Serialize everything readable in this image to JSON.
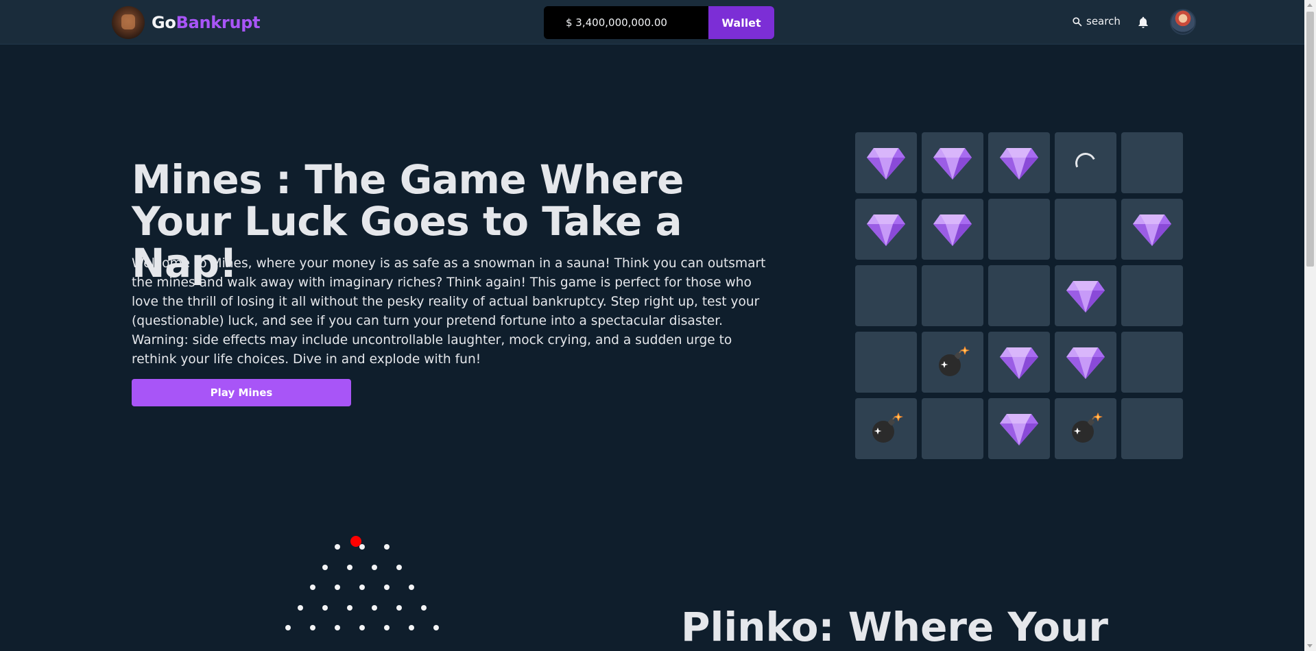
{
  "header": {
    "logo_go": "Go",
    "logo_bankrupt": "Bankrupt",
    "balance": "$ 3,400,000,000.00",
    "wallet_label": "Wallet",
    "search_label": "search"
  },
  "hero": {
    "title": "Mines : The Game Where Your Luck Goes to Take a Nap!",
    "description": "Welcome to Mines, where your money is as safe as a snowman in a sauna! Think you can outsmart the mines and walk away with imaginary riches? Think again! This game is perfect for those who love the thrill of losing it all without the pesky reality of actual bankruptcy. Step right up, test your (questionable) luck, and see if you can turn your pretend fortune into a spectacular disaster. Warning: side effects may include uncontrollable laughter, mock crying, and a sudden urge to rethink your life choices. Dive in and explode with fun!",
    "play_label": "Play Mines"
  },
  "mines_grid": [
    [
      "gem",
      "gem",
      "gem",
      "loading",
      "empty"
    ],
    [
      "gem",
      "gem",
      "empty",
      "empty",
      "gem"
    ],
    [
      "empty",
      "empty",
      "empty",
      "gem",
      "empty"
    ],
    [
      "empty",
      "bomb",
      "gem",
      "gem",
      "empty"
    ],
    [
      "bomb",
      "empty",
      "gem",
      "bomb",
      "empty"
    ]
  ],
  "plinko": {
    "title": "Plinko: Where Your"
  },
  "colors": {
    "background": "#0f1e2c",
    "header": "#1a2c3b",
    "accent": "#a855f7",
    "wallet": "#7c2ed6",
    "tile": "#2f4151",
    "ball": "#ff0000"
  },
  "icons": {
    "search": "search-icon",
    "bell": "bell-icon",
    "gem": "gem-icon",
    "bomb": "bomb-icon",
    "loading": "loading-spinner-icon"
  }
}
